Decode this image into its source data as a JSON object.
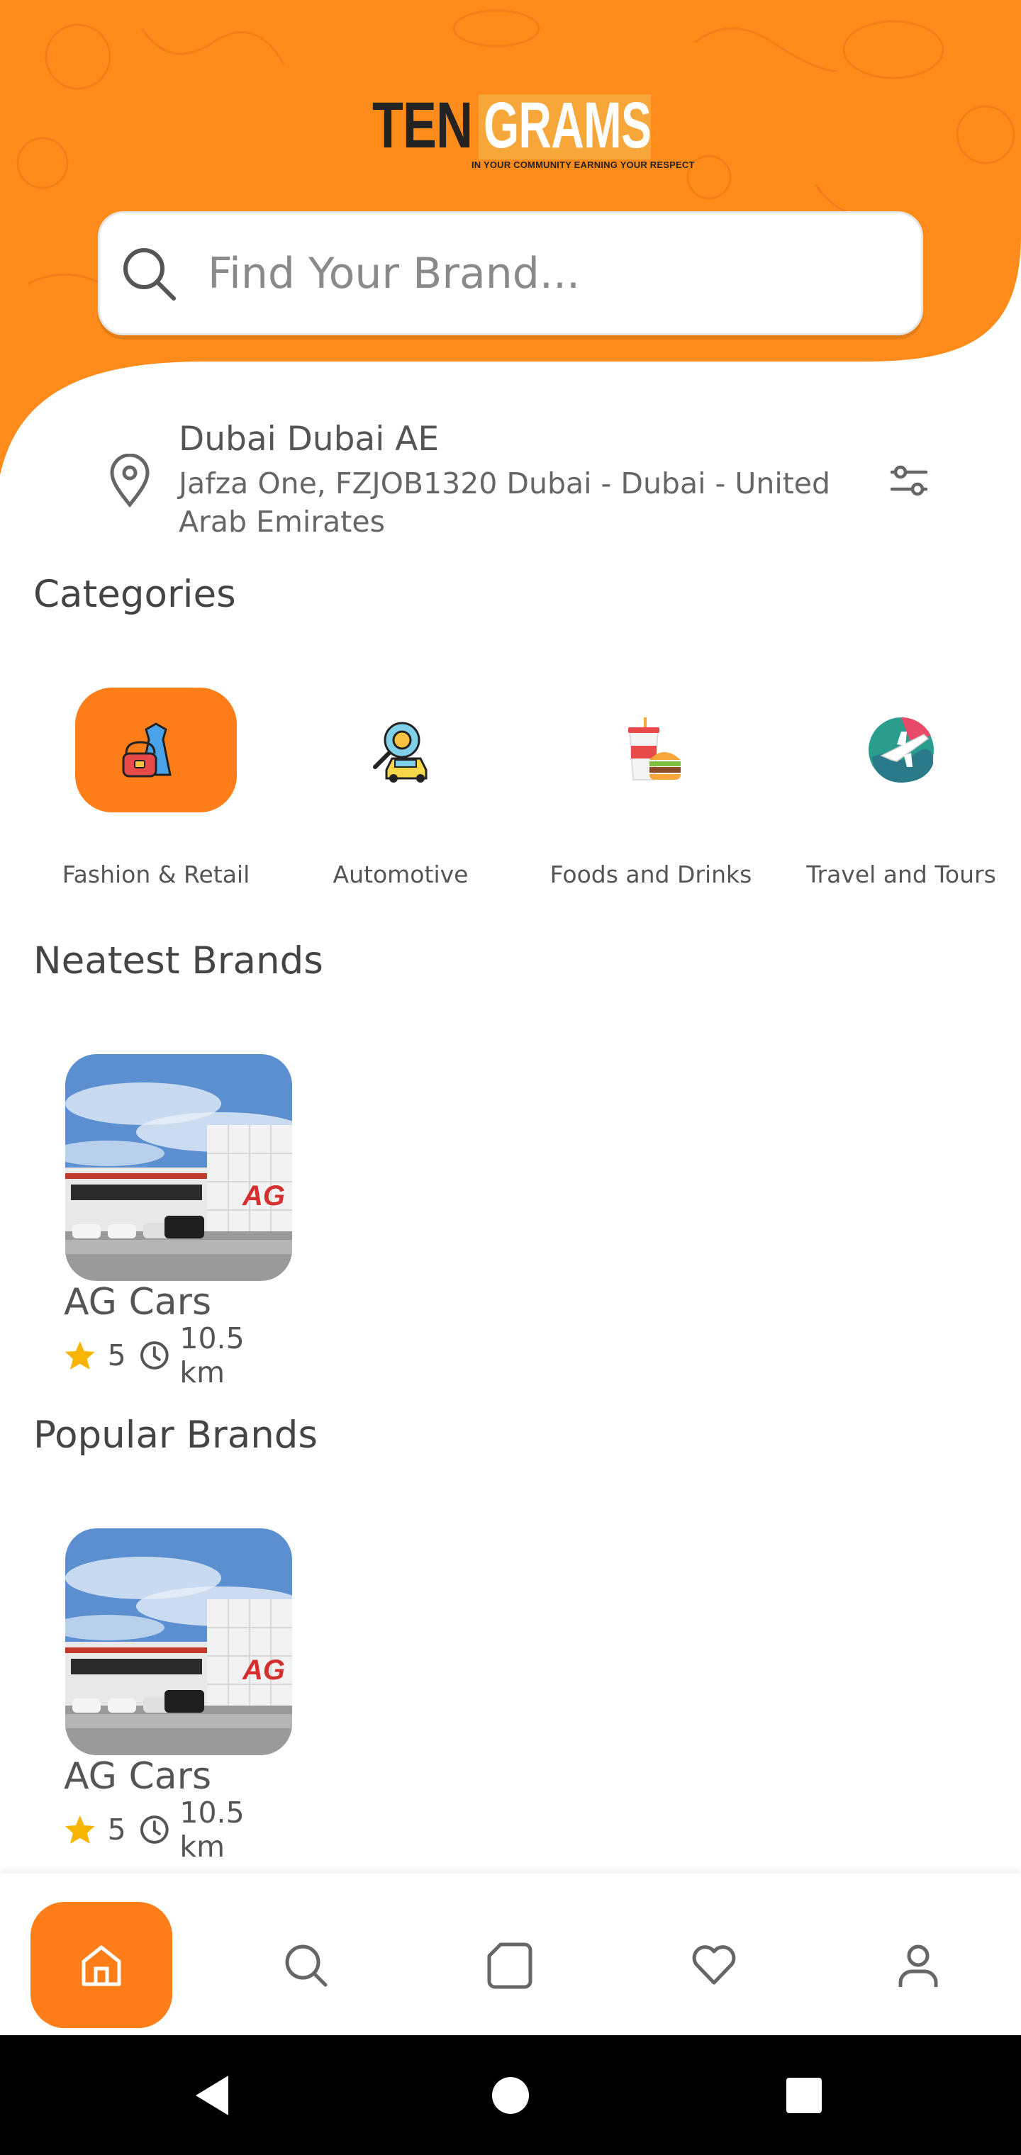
{
  "colors": {
    "brand_orange": "#ff7e1a",
    "header_orange": "#ff8c1a",
    "star": "#f7b500"
  },
  "logo": {
    "part1": "TEN",
    "part2": "GRAMS",
    "tagline": "IN YOUR COMMUNITY EARNING YOUR RESPECT"
  },
  "search": {
    "placeholder": "Find Your Brand...",
    "icon": "search-icon"
  },
  "location": {
    "title": "Dubai Dubai AE",
    "address": "Jafza One, FZJOB1320 Dubai - Dubai - United Arab Emirates",
    "icon": "location-pin-icon",
    "filter_icon": "filter-sliders-icon"
  },
  "categories": {
    "title": "Categories",
    "items": [
      {
        "label": "Fashion & Retail",
        "icon": "fashion-retail-icon",
        "selected": true
      },
      {
        "label": "Automotive",
        "icon": "automotive-icon",
        "selected": false
      },
      {
        "label": "Foods and Drinks",
        "icon": "foods-drinks-icon",
        "selected": false
      },
      {
        "label": "Travel and Tours",
        "icon": "travel-tours-icon",
        "selected": false
      }
    ]
  },
  "neatest": {
    "title": "Neatest Brands",
    "items": [
      {
        "name": "AG Cars",
        "rating": "5",
        "distance": "10.5 km"
      }
    ]
  },
  "popular": {
    "title": "Popular Brands",
    "items": [
      {
        "name": "AG Cars",
        "rating": "5",
        "distance": "10.5 km"
      }
    ]
  },
  "photo_sign": "AG",
  "bottom_nav": {
    "items": [
      {
        "name": "home",
        "icon": "home-icon",
        "active": true
      },
      {
        "name": "search",
        "icon": "search-icon",
        "active": false
      },
      {
        "name": "orders",
        "icon": "bag-icon",
        "active": false
      },
      {
        "name": "favorites",
        "icon": "heart-icon",
        "active": false
      },
      {
        "name": "profile",
        "icon": "user-icon",
        "active": false
      }
    ]
  },
  "system_nav": {
    "icons": [
      "back-icon",
      "home-circle-icon",
      "recents-icon"
    ]
  }
}
